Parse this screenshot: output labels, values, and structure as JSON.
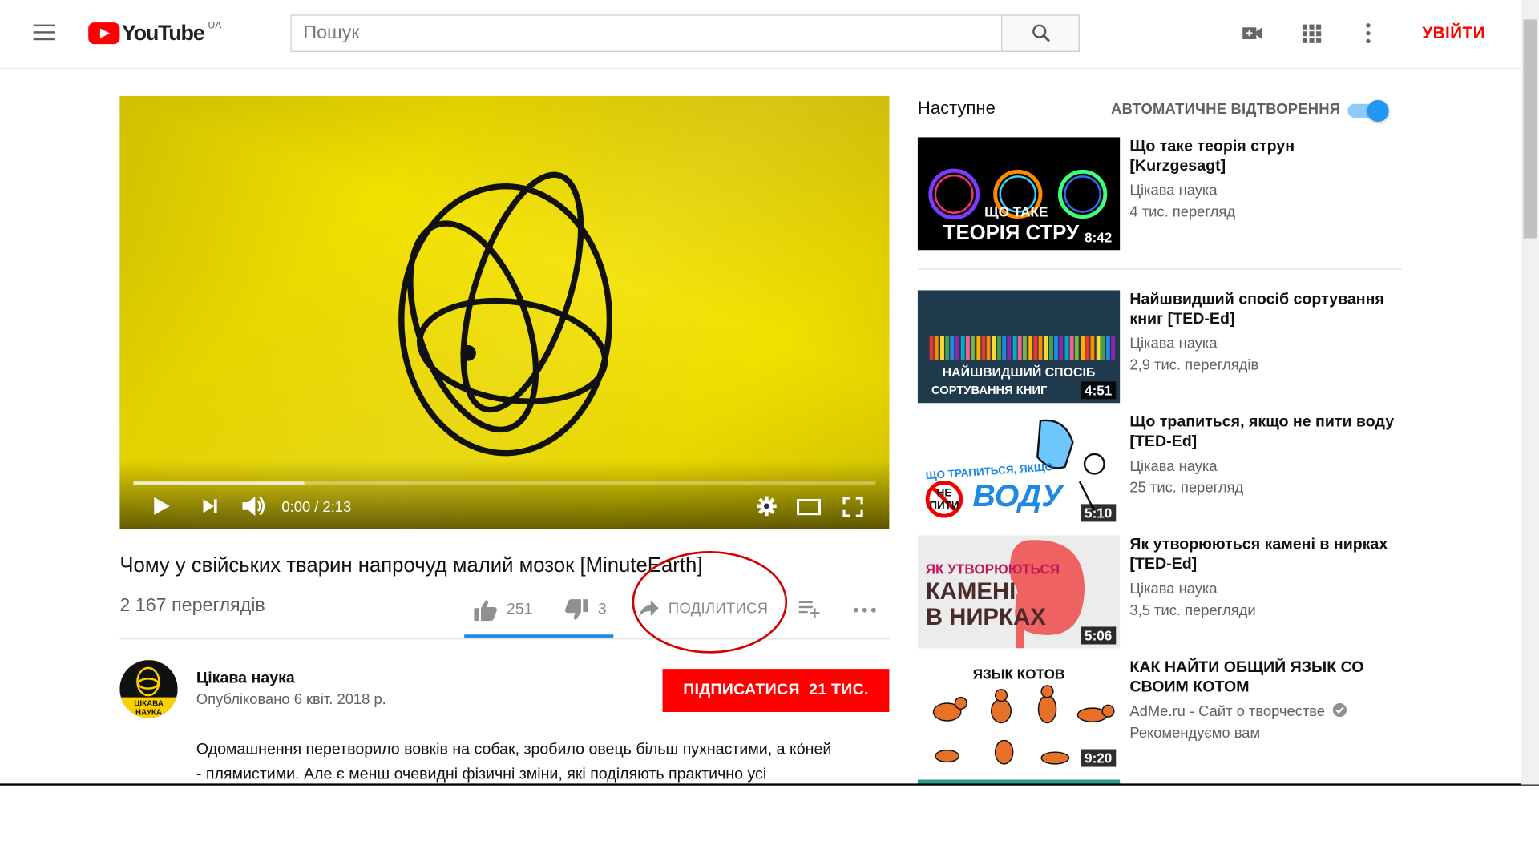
{
  "header": {
    "logo_text": "YouTube",
    "region": "UA",
    "search_placeholder": "Пошук",
    "sign_in": "УВІЙТИ"
  },
  "player": {
    "time": "0:00 / 2:13",
    "progress_buffered_fraction": 0.23
  },
  "video": {
    "title": "Чому у свійських тварин напрочуд малий мозок [MinuteEarth]",
    "views": "2 167 переглядів",
    "likes": "251",
    "dislikes": "3",
    "share_label": "ПОДІЛИТИСЯ"
  },
  "channel": {
    "name": "Цікава наука",
    "published": "Опубліковано 6 квіт. 2018 р.",
    "subscribe_label": "ПІДПИСАТИСЯ",
    "subscribe_count": "21 ТИС.",
    "avatar_text_line1": "ЦІКАВА",
    "avatar_text_line2": "НАУКА"
  },
  "description": {
    "line1": "Одомашнення перетворило вовків на собак, зробило овець більш пухнастими, а ко́ней",
    "line2": "- плямистими. Але є менш очевидні фізичні зміни, які поділяють практично усі"
  },
  "sidebar": {
    "next_label": "Наступне",
    "autoplay_label": "АВТОМАТИЧНЕ ВІДТВОРЕННЯ",
    "autoplay_on": true,
    "items": [
      {
        "title": "Що таке теорія струн [Kurzgesagt]",
        "channel": "Цікава наука",
        "views": "4 тис. перегляд",
        "duration": "8:42",
        "thumb_text1": "ЩО ТАКЕ",
        "thumb_text2": "ТЕОРІЯ СТРУ"
      },
      {
        "title": "Найшвидший спосіб сортування книг [TED-Ed]",
        "channel": "Цікава наука",
        "views": "2,9 тис. переглядів",
        "duration": "4:51",
        "thumb_text1": "НАЙШВИДШИЙ СПОСІБ",
        "thumb_text2": "СОРТУВАННЯ КНИГ"
      },
      {
        "title": "Що трапиться, якщо не пити воду [TED-Ed]",
        "channel": "Цікава наука",
        "views": "25 тис. перегляд",
        "duration": "5:10",
        "thumb_text1": "ЩО ТРАПИТЬСЯ, ЯКЩО",
        "thumb_text2": "ВОДУ",
        "thumb_text3": "НЕ ПИТИ"
      },
      {
        "title": "Як утворюються камені в нирках [TED-Ed]",
        "channel": "Цікава наука",
        "views": "3,5 тис. перегляди",
        "duration": "5:06",
        "thumb_text1": "ЯК УТВОРЮЮТЬСЯ",
        "thumb_text2": "КАМЕНІ",
        "thumb_text3": "В НИРКАХ"
      },
      {
        "title": "КАК НАЙТИ ОБЩИЙ ЯЗЫК СО СВОИМ КОТОМ",
        "channel": "AdMe.ru - Сайт о творчестве",
        "views": "Рекомендуємо вам",
        "duration": "9:20",
        "thumb_text1": "ЯЗЫК КОТОВ",
        "verified": true
      }
    ]
  },
  "colors": {
    "brand_red": "#ff0000",
    "toggle_blue": "#2196f3",
    "underline_blue": "#1e88e5",
    "annotation_red": "#d40000"
  }
}
